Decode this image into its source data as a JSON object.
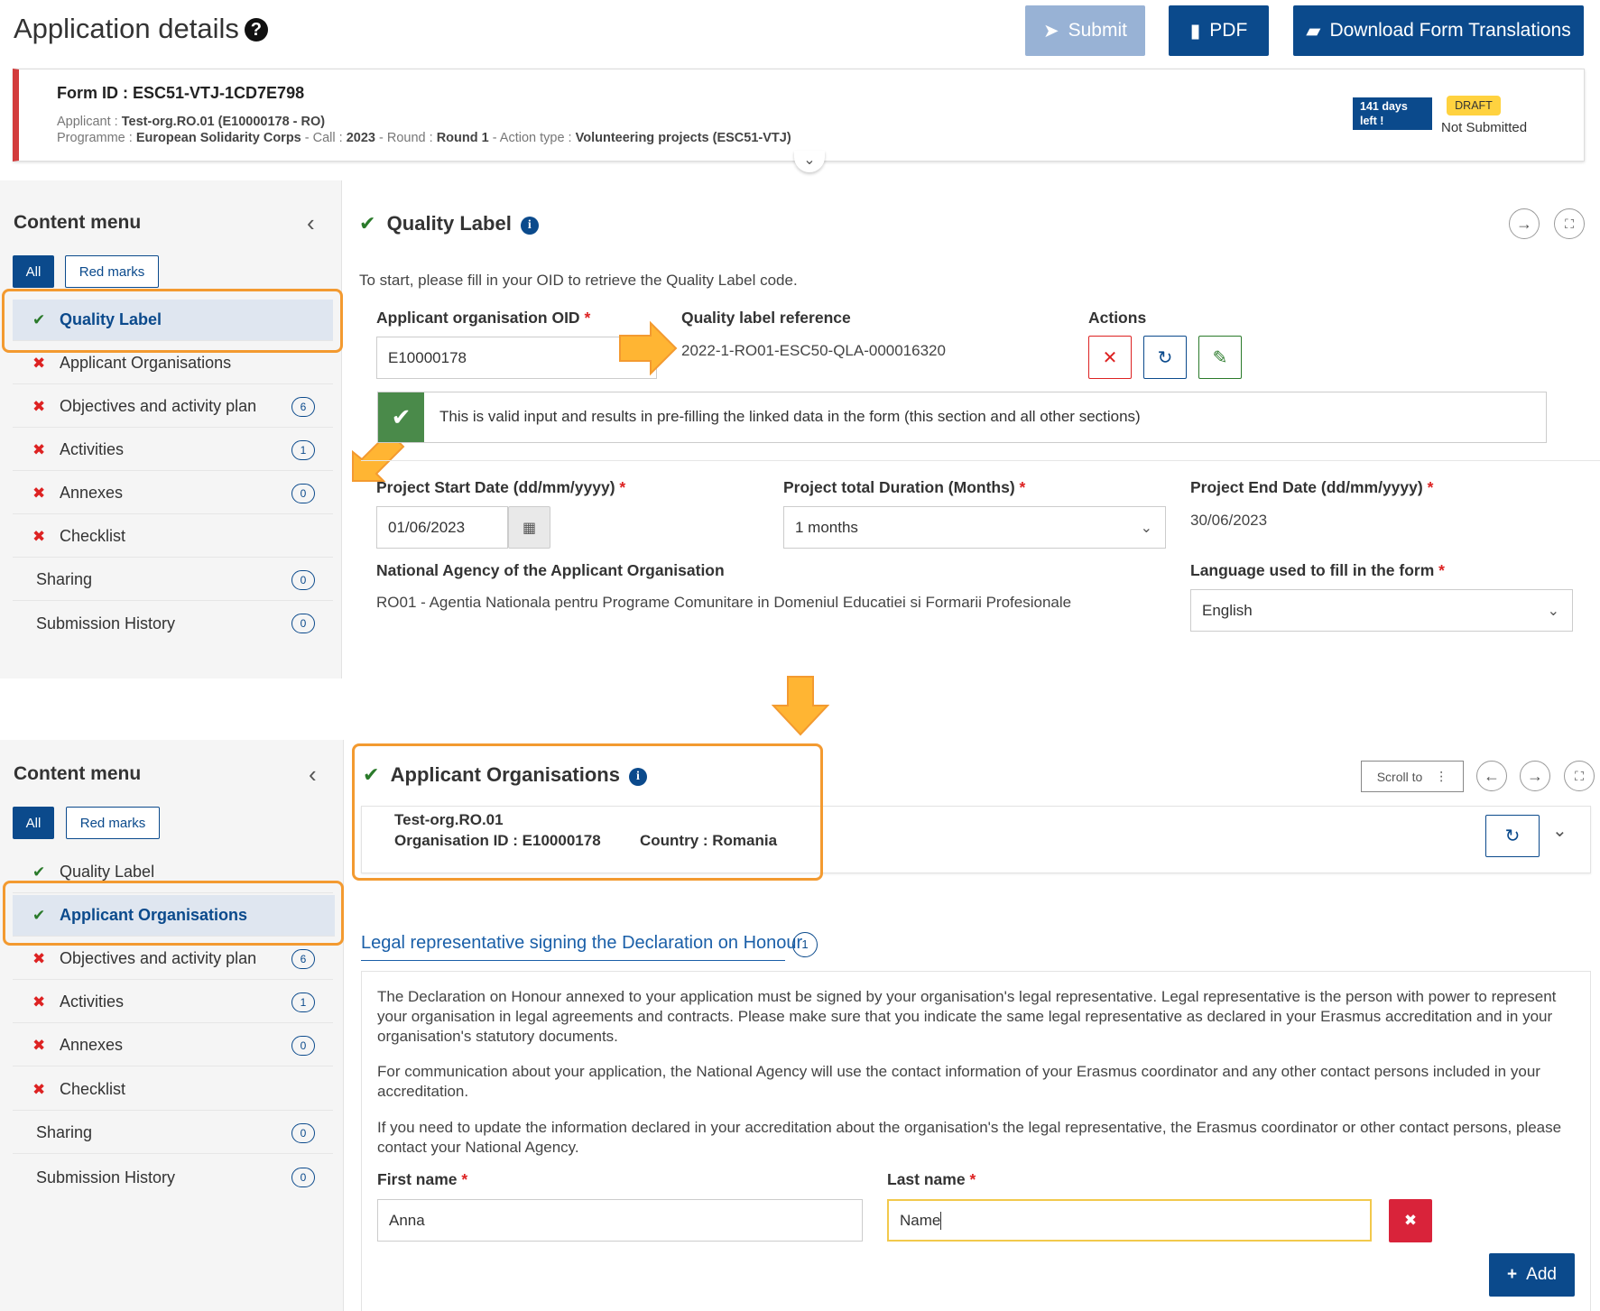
{
  "header": {
    "title": "Application details",
    "submit_label": "Submit",
    "pdf_label": "PDF",
    "download_label": "Download Form Translations"
  },
  "form": {
    "form_id": "Form ID : ESC51-VTJ-1CD7E798",
    "applicant_label": "Applicant :",
    "applicant_value": "Test-org.RO.01 (E10000178 - RO)",
    "programme_label": "Programme :",
    "programme_value": "European Solidarity Corps",
    "call_label": "- Call :",
    "call_value": "2023",
    "round_label": "- Round :",
    "round_value": "Round 1",
    "action_label": "- Action type :",
    "action_value": "Volunteering projects (ESC51-VTJ)",
    "days_line1": "141 days",
    "days_line2": "left !",
    "draft": "DRAFT",
    "status": "Not Submitted"
  },
  "menu": {
    "title": "Content menu",
    "all_label": "All",
    "red_marks_label": "Red marks",
    "top_items": [
      {
        "label": "Quality Label",
        "count": ""
      },
      {
        "label": "Applicant Organisations",
        "count": ""
      },
      {
        "label": "Objectives and activity plan",
        "count": "6"
      },
      {
        "label": "Activities",
        "count": "1"
      },
      {
        "label": "Annexes",
        "count": "0"
      },
      {
        "label": "Checklist",
        "count": ""
      },
      {
        "label": "Sharing",
        "count": "0"
      },
      {
        "label": "Submission History",
        "count": "0"
      }
    ]
  },
  "quality": {
    "title": "Quality Label",
    "intro": "To start, please fill in your OID to retrieve the Quality Label code.",
    "oid_label": "Applicant organisation OID",
    "oid_value": "E10000178",
    "ref_label": "Quality label reference",
    "ref_value": "2022-1-RO01-ESC50-QLA-000016320",
    "actions_label": "Actions",
    "valid_text": "This is valid input and results in pre-filling the linked data in the form (this section and all other sections)",
    "start_label": "Project Start Date (dd/mm/yyyy)",
    "start_value": "01/06/2023",
    "duration_label": "Project total Duration (Months)",
    "duration_value": "1 months",
    "end_label": "Project End Date (dd/mm/yyyy)",
    "end_value": "30/06/2023",
    "agency_label": "National Agency of the Applicant Organisation",
    "agency_value": "RO01 - Agentia Nationala pentru Programe Comunitare in Domeniul Educatiei si Formarii Profesionale",
    "language_label": "Language used to fill in the form",
    "language_value": "English"
  },
  "applicant": {
    "title": "Applicant Organisations",
    "org_name": "Test-org.RO.01",
    "org_id": "Organisation ID : E10000178",
    "country": "Country : Romania",
    "scroll_to": "Scroll to",
    "legal_title": "Legal representative signing the Declaration on Honour",
    "legal_count": "1",
    "para1": "The Declaration on Honour annexed to your application must be signed by your organisation's legal representative. Legal representative is the person with power to represent your organisation in legal agreements and contracts. Please make sure that you indicate the same legal representative as declared in your Erasmus accreditation and in your organisation's statutory documents.",
    "para2": "For communication about your application, the National Agency will use the contact information of your Erasmus coordinator and any other contact persons included in your accreditation.",
    "para3": "If you need to update the information declared in your accreditation about the organisation's the legal representative, the Erasmus coordinator or other contact persons, please contact your National Agency.",
    "first_label": "First name",
    "first_value": "Anna",
    "last_label": "Last name",
    "last_value": "Name",
    "add_label": "Add"
  },
  "colors": {
    "primary": "#0b4a8c",
    "accent_orange": "#f39a30",
    "error_red": "#d22222",
    "success_green": "#2a7a2a"
  }
}
